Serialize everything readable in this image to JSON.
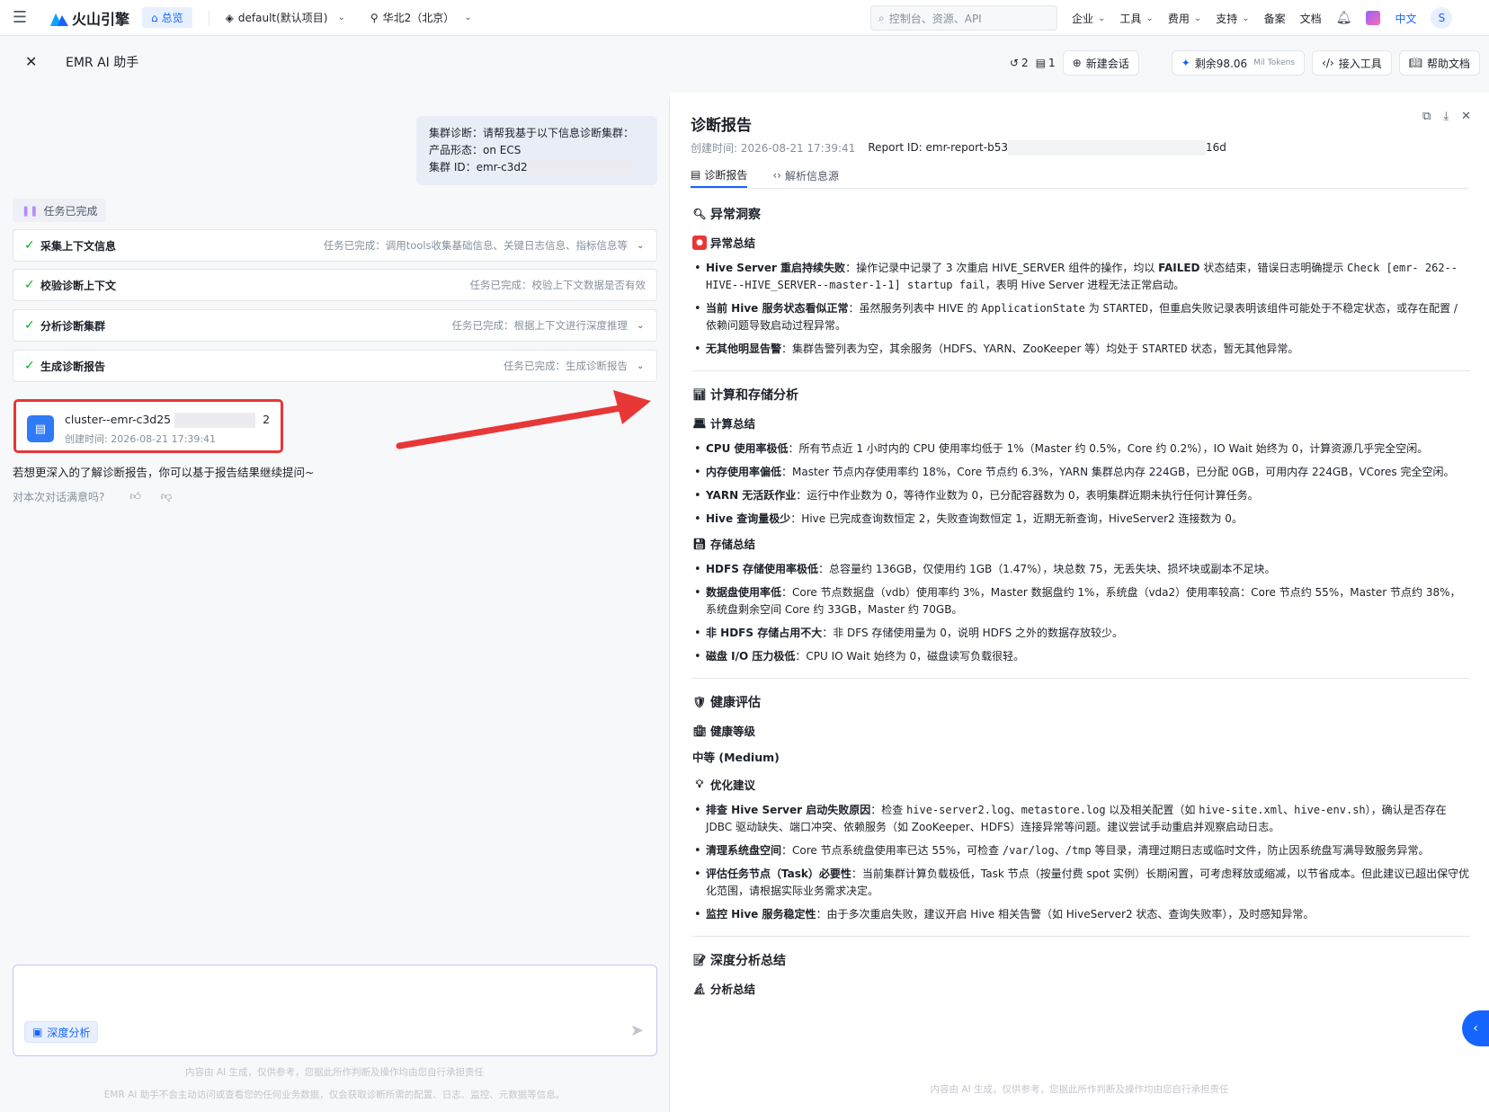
{
  "topnav": {
    "brand": "火山引擎",
    "home": "总览",
    "project": "default(默认项目)",
    "region": "华北2（北京）",
    "search_placeholder": "控制台、资源、API",
    "menus": [
      "企业",
      "工具",
      "费用",
      "支持",
      "备案",
      "文档"
    ],
    "lang": "中文",
    "avatar": "S"
  },
  "header": {
    "title": "EMR AI 助手",
    "history_count": "2",
    "doc_count": "1",
    "new_chat": "新建会话",
    "tokens_label": "剩余98.06",
    "tokens_unit": "Mil Tokens",
    "connect_tools": "接入工具",
    "help_docs": "帮助文档"
  },
  "chat": {
    "user_message": {
      "line1": "集群诊断：请帮我基于以下信息诊断集群：",
      "line2": "产品形态：on ECS",
      "line3": "集群 ID：emr-c3d2"
    },
    "task_done": "任务已完成",
    "steps": [
      {
        "name": "采集上下文信息",
        "status": "任务已完成：调用tools收集基础信息、关键日志信息、指标信息等",
        "expandable": true
      },
      {
        "name": "校验诊断上下文",
        "status": "任务已完成：校验上下文数据是否有效",
        "expandable": false
      },
      {
        "name": "分析诊断集群",
        "status": "任务已完成：根据上下文进行深度推理",
        "expandable": true
      },
      {
        "name": "生成诊断报告",
        "status": "任务已完成：生成诊断报告",
        "expandable": true
      }
    ],
    "file": {
      "name": "cluster--emr-c3d25",
      "name_tail": "2",
      "created": "创建时间: 2026-08-21 17:39:41"
    },
    "followup": "若想更深入的了解诊断报告，你可以基于报告结果继续提问~",
    "satisfaction": "对本次对话满意吗?",
    "deep_analysis": "深度分析",
    "disclaimer1": "内容由 AI 生成，仅供参考，您据此所作判断及操作均由您自行承担责任",
    "disclaimer2": "EMR AI 助手不会主动访问或查看您的任何业务数据，仅会获取诊断所需的配置、日志、监控、元数据等信息。"
  },
  "report": {
    "title": "诊断报告",
    "created": "创建时间: 2026-08-21 17:39:41",
    "report_id": "Report ID: emr-report-b53",
    "report_id_tail": "16d",
    "tabs": [
      "诊断报告",
      "解析信息源"
    ],
    "s1_title": "异常洞察",
    "s1_sub": "异常总结",
    "s1_items": [
      {
        "key": "Hive Server 重启持续失败",
        "text": "：操作记录中记录了 3 次重启 HIVE_SERVER 组件的操作，均以 ",
        "bold2": "FAILED",
        "text2": " 状态结束，错误日志明确提示 ",
        "code": "Check [emr-                   262--HIVE--HIVE_SERVER--master-1-1] startup fail",
        "text3": "，表明 Hive Server 进程无法正常启动。"
      },
      {
        "key": "当前 Hive 服务状态看似正常",
        "text": "：虽然服务列表中 HIVE 的 ",
        "code": "ApplicationState",
        "text2": " 为 ",
        "code2": "STARTED",
        "text3": "，但重启失败记录表明该组件可能处于不稳定状态，或存在配置 / 依赖问题导致启动过程异常。"
      },
      {
        "key": "无其他明显告警",
        "text": "：集群告警列表为空，其余服务（HDFS、YARN、ZooKeeper 等）均处于 ",
        "code": "STARTED",
        "text2": " 状态，暂无其他异常。"
      }
    ],
    "s2_title": "计算和存储分析",
    "s2_sub1": "计算总结",
    "s2_items1": [
      {
        "key": "CPU 使用率极低",
        "text": "：所有节点近 1 小时内的 CPU 使用率均低于 1%（Master 约 0.5%，Core 约 0.2%），IO Wait 始终为 0，计算资源几乎完全空闲。"
      },
      {
        "key": "内存使用率偏低",
        "text": "：Master 节点内存使用率约 18%，Core 节点约 6.3%，YARN 集群总内存 224GB，已分配 0GB，可用内存 224GB，VCores 完全空闲。"
      },
      {
        "key": "YARN 无活跃作业",
        "text": "：运行中作业数为 0，等待作业数为 0，已分配容器数为 0，表明集群近期未执行任何计算任务。"
      },
      {
        "key": "Hive 查询量极少",
        "text": "：Hive 已完成查询数恒定 2，失败查询数恒定 1，近期无新查询，HiveServer2 连接数为 0。"
      }
    ],
    "s2_sub2": "存储总结",
    "s2_items2": [
      {
        "key": "HDFS 存储使用率极低",
        "text": "：总容量约 136GB，仅使用约 1GB（1.47%），块总数 75，无丢失块、损坏块或副本不足块。"
      },
      {
        "key": "数据盘使用率低",
        "text": "：Core 节点数据盘（vdb）使用率约 3%，Master 数据盘约 1%，系统盘（vda2）使用率较高：Core 节点约 55%，Master 节点约 38%，系统盘剩余空间 Core 约 33GB，Master 约 70GB。"
      },
      {
        "key": "非 HDFS 存储占用不大",
        "text": "：非 DFS 存储使用量为 0，说明 HDFS 之外的数据存放较少。"
      },
      {
        "key": "磁盘 I/O 压力极低",
        "text": "：CPU IO Wait 始终为 0，磁盘读写负载很轻。"
      }
    ],
    "s3_title": "健康评估",
    "s3_sub1": "健康等级",
    "s3_grade": "中等 (Medium)",
    "s3_sub2": "优化建议",
    "s3_items": [
      {
        "key": "排查 Hive Server 启动失败原因",
        "text": "：检查 ",
        "code": "hive-server2.log",
        "sep1": "、",
        "code2": "metastore.log",
        "text2": " 以及相关配置（如 ",
        "code3": "hive-site.xml",
        "sep2": "、",
        "code4": "hive-env.sh",
        "text3": "），确认是否存在 JDBC 驱动缺失、端口冲突、依赖服务（如 ZooKeeper、HDFS）连接异常等问题。建议尝试手动重启并观察启动日志。"
      },
      {
        "key": "清理系统盘空间",
        "text": "：Core 节点系统盘使用率已达 55%，可检查 ",
        "code": "/var/log",
        "sep1": "、",
        "code2": "/tmp",
        "text2": " 等目录，清理过期日志或临时文件，防止因系统盘写满导致服务异常。"
      },
      {
        "key": "评估任务节点（Task）必要性",
        "text": "：当前集群计算负载极低，Task 节点（按量付费 spot 实例）长期闲置，可考虑释放或缩减，以节省成本。但此建议已超出保守优化范围，请根据实际业务需求决定。"
      },
      {
        "key": "监控 Hive 服务稳定性",
        "text": "：由于多次重启失败，建议开启 Hive 相关告警（如 HiveServer2 状态、查询失败率），及时感知异常。"
      }
    ],
    "s4_title": "深度分析总结",
    "s4_sub": "分析总结",
    "footer": "内容由 AI 生成，仅供参考，您据此所作判断及操作均由您自行承担责任"
  }
}
